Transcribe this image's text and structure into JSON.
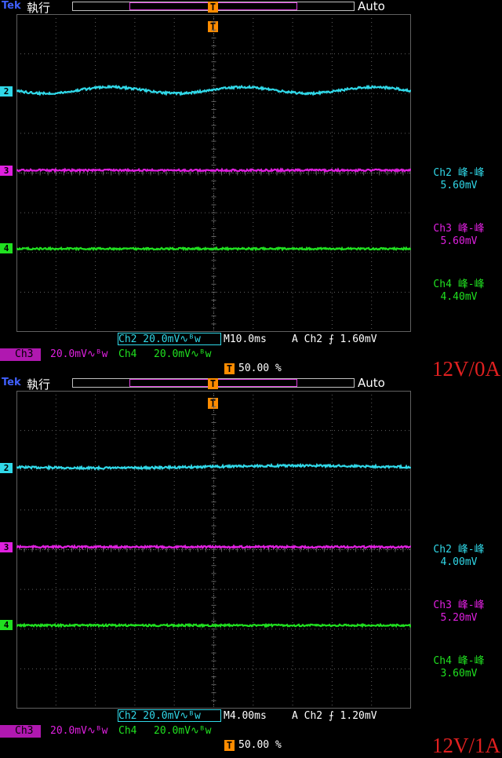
{
  "colors": {
    "ch2": "#30d8e8",
    "ch3": "#e020e0",
    "ch4": "#20e020",
    "grid": "#606060",
    "trigger": "#ff8c00",
    "annot": "#e02020"
  },
  "screens": [
    {
      "brand": "Tek",
      "run_state": "執行",
      "trigger_mode": "Auto",
      "measurements": [
        {
          "label": "Ch2 峰-峰",
          "value": "5.60mV"
        },
        {
          "label": "Ch3 峰-峰",
          "value": "5.60mV"
        },
        {
          "label": "Ch4 峰-峰",
          "value": "4.40mV"
        }
      ],
      "ch2_scale": "Ch2  20.0mV∿ᴮw",
      "ch3_scale": "Ch3",
      "ch3_scale_val": "20.0mV∿ᴮw",
      "ch4_scale": "Ch4",
      "ch4_scale_val": "20.0mV∿ᴮw",
      "timebase": "M10.0ms",
      "trig_src": "A  Ch2 ⨍ 1.60mV",
      "trig_pos": "50.00 %",
      "condition": "12V/0A",
      "ch_markers": [
        "2",
        "3",
        "4"
      ],
      "ch2_ripple_cycles": 3
    },
    {
      "brand": "Tek",
      "run_state": "執行",
      "trigger_mode": "Auto",
      "measurements": [
        {
          "label": "Ch2 峰-峰",
          "value": "4.00mV"
        },
        {
          "label": "Ch3 峰-峰",
          "value": "5.20mV"
        },
        {
          "label": "Ch4 峰-峰",
          "value": "3.60mV"
        }
      ],
      "ch2_scale": "Ch2  20.0mV∿ᴮw",
      "ch3_scale": "Ch3",
      "ch3_scale_val": "20.0mV∿ᴮw",
      "ch4_scale": "Ch4",
      "ch4_scale_val": "20.0mV∿ᴮw",
      "timebase": "M4.00ms",
      "trig_src": "A  Ch2 ⨍ 1.20mV",
      "trig_pos": "50.00 %",
      "condition": "12V/1A",
      "ch_markers": [
        "2",
        "3",
        "4"
      ],
      "ch2_ripple_cycles": 1
    }
  ]
}
